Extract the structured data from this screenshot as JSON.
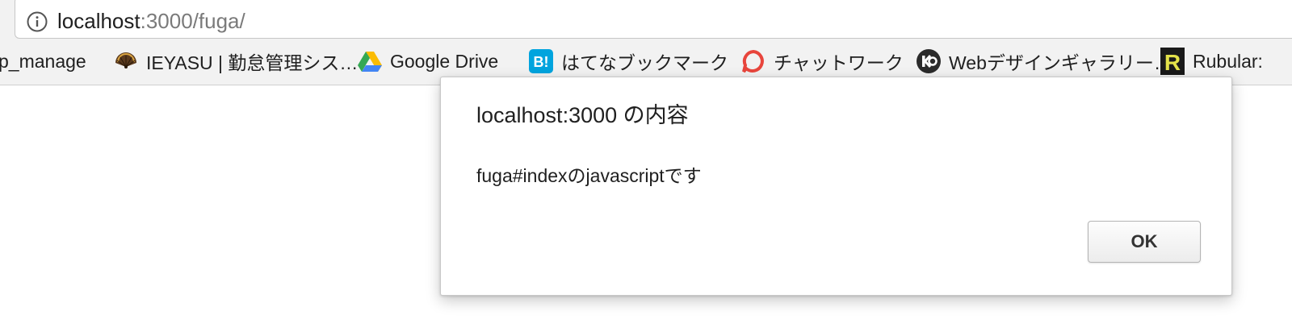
{
  "address_bar": {
    "host": "localhost",
    "path": ":3000/fuga/"
  },
  "bookmarks": [
    {
      "label": "p_manage",
      "icon": "none"
    },
    {
      "label": "IEYASU | 勤怠管理シス…",
      "icon": "folding-fan-icon"
    },
    {
      "label": "Google Drive",
      "icon": "google-drive-icon"
    },
    {
      "label": "はてなブックマーク",
      "icon": "hatena-bookmark-icon"
    },
    {
      "label": "チャットワーク",
      "icon": "chatwork-icon"
    },
    {
      "label": "Webデザインギャラリー…",
      "icon": "ko-logo-icon"
    },
    {
      "label": "Rubular:",
      "icon": "rubular-icon"
    }
  ],
  "dialog": {
    "title": "localhost:3000 の内容",
    "message": "fuga#indexのjavascriptです",
    "ok_label": "OK"
  },
  "colors": {
    "chrome_bg": "#f2f2f2",
    "hatena_blue": "#00a4de",
    "chatwork_red": "#e8453c",
    "rubular_yellow": "#e4e24a"
  }
}
